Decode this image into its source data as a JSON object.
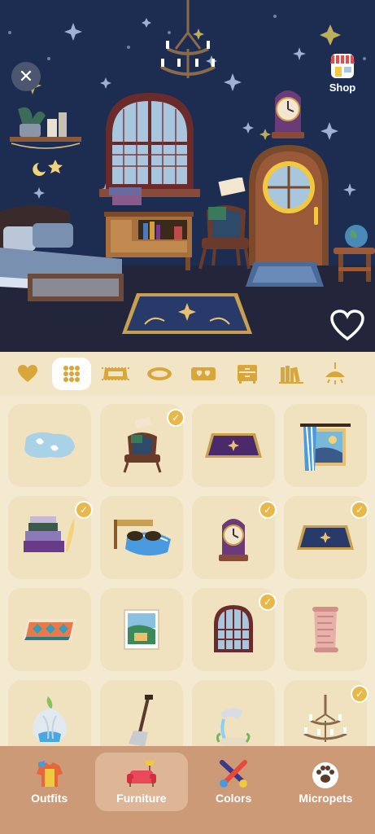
{
  "header": {
    "shop_label": "Shop"
  },
  "categories": [
    {
      "icon": "heart-icon"
    },
    {
      "icon": "grid-icon"
    },
    {
      "icon": "rug-icon"
    },
    {
      "icon": "oval-rug-icon"
    },
    {
      "icon": "heart-rug-icon"
    },
    {
      "icon": "dresser-icon"
    },
    {
      "icon": "books-icon"
    },
    {
      "icon": "ceiling-lamp-icon"
    }
  ],
  "items": [
    {
      "name": "blue-rug",
      "owned": false
    },
    {
      "name": "reading-chair",
      "owned": true
    },
    {
      "name": "purple-rug",
      "owned": false
    },
    {
      "name": "window-with-curtain",
      "owned": false
    },
    {
      "name": "book-stack",
      "owned": true
    },
    {
      "name": "cat-bed",
      "owned": false
    },
    {
      "name": "purple-clock",
      "owned": true
    },
    {
      "name": "navy-rug",
      "owned": true
    },
    {
      "name": "patterned-rug",
      "owned": false
    },
    {
      "name": "framed-poster",
      "owned": false
    },
    {
      "name": "arched-window",
      "owned": true
    },
    {
      "name": "scroll",
      "owned": false
    },
    {
      "name": "onion-lamp",
      "owned": false
    },
    {
      "name": "shovel",
      "owned": false
    },
    {
      "name": "water-fountain",
      "owned": false
    },
    {
      "name": "chandelier",
      "owned": true
    }
  ],
  "bottom_nav": [
    {
      "label": "Outfits",
      "active": false
    },
    {
      "label": "Furniture",
      "active": true
    },
    {
      "label": "Colors",
      "active": false
    },
    {
      "label": "Micropets",
      "active": false
    }
  ],
  "colors": {
    "accent": "#e9b84a",
    "nav_bg": "#cd9a77",
    "scene_bg": "#1d2d52"
  }
}
